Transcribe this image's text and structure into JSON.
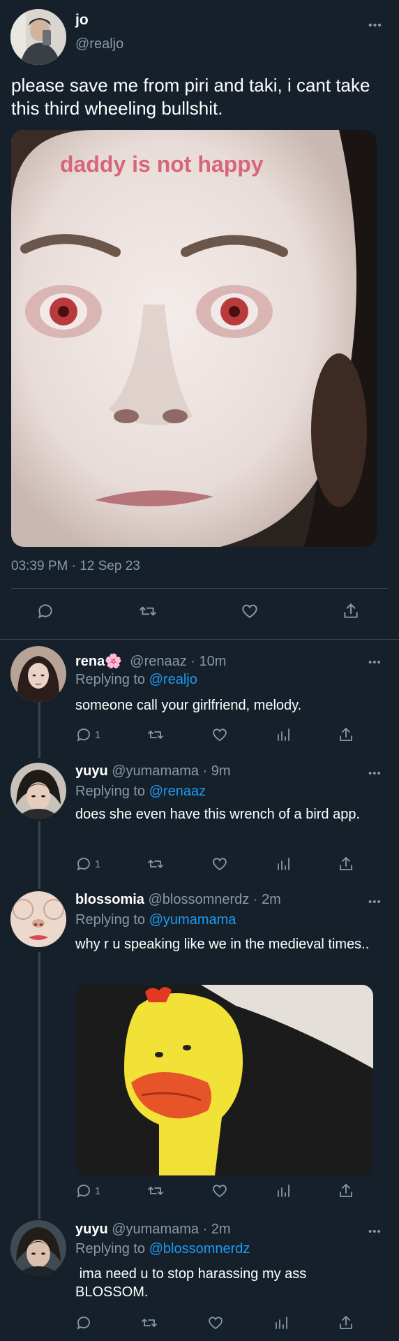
{
  "main_tweet": {
    "name": "jo",
    "handle": "@realjo",
    "more": "•••",
    "text": "please save me from piri and taki, i cant take this third wheeling bullshit.",
    "media_caption": "daddy is not happy",
    "timestamp": "03:39 PM · 12 Sep 23",
    "actions": [
      "reply-icon",
      "retweet-icon",
      "like-icon",
      "share-icon"
    ]
  },
  "replies": [
    {
      "name": "rena🌸",
      "meta": "@renaaz · 10m",
      "replying_label": "Replying to",
      "replying_to": "@realjo",
      "text": "someone call your girlfriend, melody.",
      "reply_count": "1"
    },
    {
      "name": "yuyu",
      "meta": "@yumamama · 9m",
      "replying_label": "Replying to",
      "replying_to": "@renaaz",
      "text": "does she even have this wrench of a bird app.",
      "reply_count": "1"
    },
    {
      "name": "blossomia",
      "meta": "@blossomnerdz · 2m",
      "replying_label": "Replying to",
      "replying_to": "@yumamama",
      "text": "why r u speaking like we in the medieval times..",
      "reply_count": "1"
    },
    {
      "name": "yuyu",
      "meta": "@yumamama · 2m",
      "replying_label": "Replying to",
      "replying_to": "@blossomnerdz",
      "text": " ima need u to stop harassing my ass BLOSSOM.",
      "reply_count": ""
    }
  ],
  "colors": {
    "background": "#15202b",
    "muted": "#8899a6",
    "link": "#1d9bf0",
    "divider": "#38444d"
  }
}
